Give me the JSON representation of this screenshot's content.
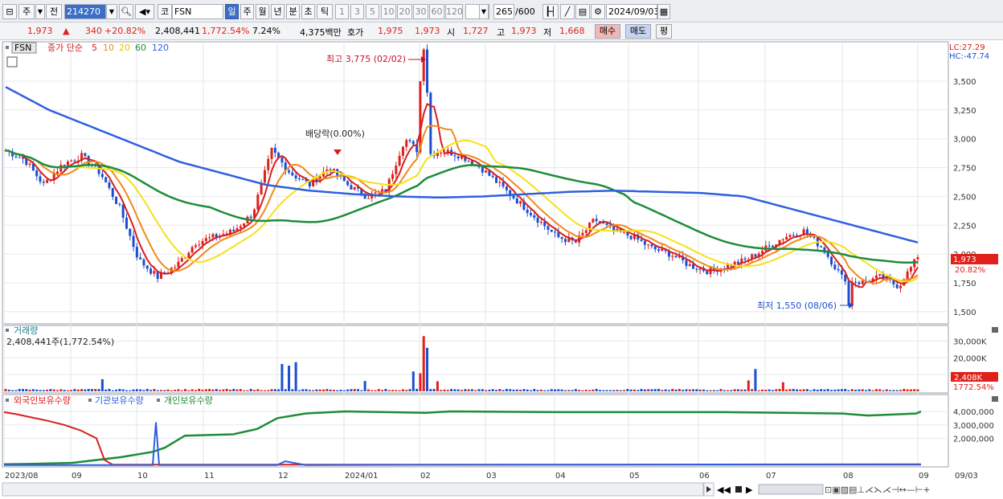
{
  "toolbar": {
    "period_day": "주",
    "prev": "전",
    "stock_code": "214270",
    "market": "코",
    "stock_name": "FSN",
    "tabs": [
      "일",
      "주",
      "월",
      "년",
      "분",
      "초",
      "틱"
    ],
    "active_tab": "일",
    "intervals": [
      "1",
      "3",
      "5",
      "10",
      "20",
      "30",
      "60",
      "120"
    ],
    "count": "265",
    "total": "/600",
    "date": "2024/09/03"
  },
  "quote": {
    "price": "1,973",
    "change": "340",
    "change_pct": "+20.82%",
    "volume": "2,408,441",
    "volume_ratio": "1,772.54%",
    "turnover": "7.24%",
    "amount": "4,375백만",
    "bid_label": "호가",
    "bid": "1,975",
    "ask": "1,973",
    "open_label": "시",
    "open": "1,727",
    "high_label": "고",
    "high": "1,973",
    "low_label": "저",
    "low": "1,668",
    "buy_label": "매수",
    "sell_label": "매도",
    "eval_label": "평"
  },
  "price_panel": {
    "ticker_tag": "FSN",
    "legend_title": "종가 단순",
    "ma": [
      {
        "label": "5",
        "color": "#d81e1e"
      },
      {
        "label": "10",
        "color": "#f08a1a"
      },
      {
        "label": "20",
        "color": "#f5e11a"
      },
      {
        "label": "60",
        "color": "#1e8c3a"
      },
      {
        "label": "120",
        "color": "#2f5fe0"
      }
    ],
    "lc": "LC:27.29",
    "hc": "HC:-47.74",
    "max_note": "최고 3,775 (02/02)",
    "min_note": "최저 1,550 (08/06)",
    "dividend_note": "배당락(0.00%)",
    "current_price_tag": "1,973",
    "current_pct_tag": "20.82%",
    "y_ticks": [
      "3,500",
      "3,250",
      "3,000",
      "2,750",
      "2,500",
      "2,250",
      "2,000",
      "1,750",
      "1,500"
    ]
  },
  "volume_panel": {
    "title": "거래량",
    "value": "2,408,441주(1,772.54%)",
    "y_ticks": [
      "30,000K",
      "20,000K",
      "10,000K"
    ],
    "tag_value": "2,408K",
    "tag_pct": "1772.54%"
  },
  "holdings_panel": {
    "legend": [
      "외국인보유수량",
      "기관보유수량",
      "개인보유수량"
    ],
    "colors": [
      "#d81e1e",
      "#2f5fe0",
      "#1e8c3a"
    ],
    "y_ticks": [
      "4,000,000",
      "3,000,000",
      "2,000,000"
    ]
  },
  "x_axis": {
    "labels": [
      "2023/08",
      "09",
      "10",
      "11",
      "12",
      "2024/01",
      "02",
      "03",
      "04",
      "05",
      "06",
      "07",
      "08",
      "09"
    ],
    "right_label": "09/03"
  },
  "chart_data": {
    "type": "line",
    "title": "",
    "series": [
      {
        "name": "종가 단순 5",
        "values": [
          2900,
          2820,
          2600,
          2780,
          2850,
          2700,
          2400,
          1950,
          1800,
          1900,
          2100,
          2150,
          2200,
          2350,
          2900,
          2700,
          2600,
          2750,
          2600,
          2500,
          2550,
          3000,
          2850,
          2900,
          2850,
          2750,
          2600,
          2450,
          2300,
          2150,
          2100,
          2300,
          2200,
          2150,
          2050,
          2000,
          1900,
          1850,
          1900,
          1950,
          2050,
          2150,
          2200,
          2050,
          1800,
          1750,
          1800,
          1720,
          1973
        ]
      },
      {
        "name": "120",
        "values": [
          3450,
          3250,
          3100,
          2950,
          2800,
          2700,
          2600,
          2550,
          2520,
          2500,
          2490,
          2500,
          2520,
          2540,
          2550,
          2540,
          2530,
          2500,
          2400,
          2300,
          2200,
          2100
        ]
      }
    ],
    "ylim": [
      1450,
      3800
    ],
    "max_point": {
      "date": "02/02",
      "value": 3775
    },
    "min_point": {
      "date": "08/06",
      "value": 1550
    },
    "last": {
      "date": "09/03",
      "open": 1727,
      "high": 1973,
      "low": 1668,
      "close": 1973
    }
  }
}
